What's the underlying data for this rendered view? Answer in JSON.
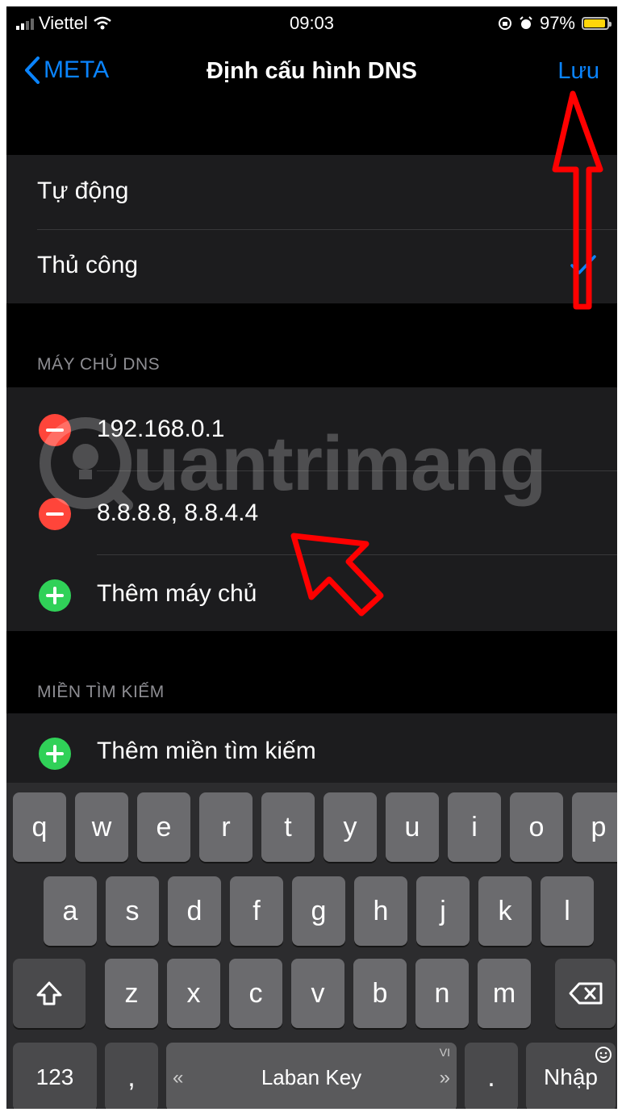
{
  "status_bar": {
    "carrier": "Viettel",
    "time": "09:03",
    "battery": "97%",
    "battery_level": 0.97
  },
  "nav": {
    "back_label": "META",
    "title": "Định cấu hình DNS",
    "save_label": "Lưu"
  },
  "mode_options": [
    {
      "label": "Tự động",
      "selected": false
    },
    {
      "label": "Thủ công",
      "selected": true
    }
  ],
  "dns_section": {
    "header": "MÁY CHỦ DNS",
    "servers": [
      "192.168.0.1",
      "8.8.8.8, 8.8.4.4"
    ],
    "add_label": "Thêm máy chủ"
  },
  "search_section": {
    "header": "MIỀN TÌM KIẾM",
    "add_label": "Thêm miền tìm kiếm"
  },
  "watermark": {
    "text": "uantrimang"
  },
  "keyboard": {
    "row1": [
      "q",
      "w",
      "e",
      "r",
      "t",
      "y",
      "u",
      "i",
      "o",
      "p"
    ],
    "row2": [
      "a",
      "s",
      "d",
      "f",
      "g",
      "h",
      "j",
      "k",
      "l"
    ],
    "row3": [
      "z",
      "x",
      "c",
      "v",
      "b",
      "n",
      "m"
    ],
    "numbers_label": "123",
    "comma": ",",
    "space_label": "Laban Key",
    "space_left": "«",
    "space_right": "»",
    "space_lang": "VI",
    "period": ".",
    "return_label": "Nhập"
  },
  "colors": {
    "accent": "#0a84ff",
    "delete": "#ff453a",
    "add": "#30d158",
    "annotation": "#ff0000"
  }
}
